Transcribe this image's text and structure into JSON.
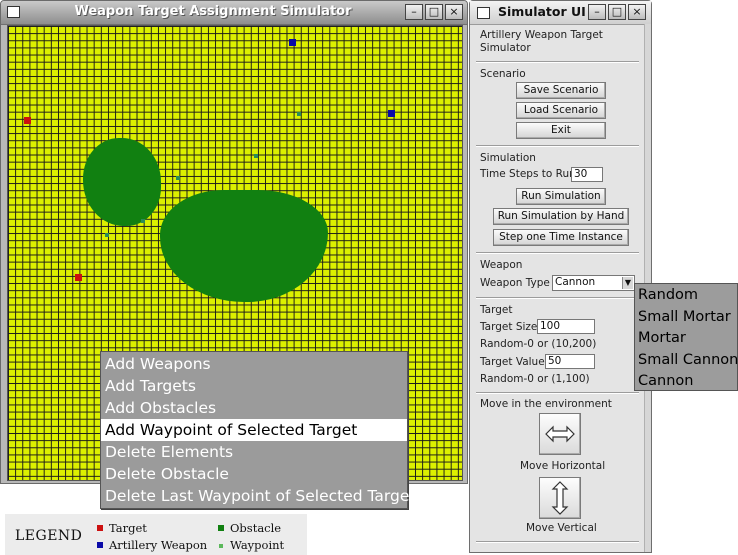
{
  "main_window": {
    "title": "Weapon Target Assignment Simulator",
    "controls": {
      "minimize": "–",
      "maximize": "□",
      "close": "×"
    }
  },
  "context_menu": {
    "items": [
      "Add Weapons",
      "Add Targets",
      "Add Obstacles",
      "Add Waypoint of Selected Target",
      "Delete Elements",
      "Delete Obstacle",
      "Delete Last Waypoint of Selected Target"
    ],
    "selected": "Add Waypoint of Selected Target"
  },
  "legend": {
    "title": "LEGEND",
    "items": {
      "target": {
        "label": "Target",
        "color": "#cc1010"
      },
      "artillery": {
        "label": "Artillery Weapon",
        "color": "#0a0aa8"
      },
      "obstacle": {
        "label": "Obstacle",
        "color": "#118011"
      },
      "waypoint": {
        "label": "Waypoint",
        "color": "#5bb85b"
      }
    }
  },
  "ui_window": {
    "title": "Simulator UI",
    "controls": {
      "minimize": "–",
      "maximize": "□",
      "close": "×"
    },
    "subtitle_line1": "Artillery Weapon Target",
    "subtitle_line2": "Simulator",
    "scenario": {
      "heading": "Scenario",
      "save": "Save Scenario",
      "load": "Load Scenario",
      "exit": "Exit"
    },
    "simulation": {
      "heading": "Simulation",
      "time_steps_label": "Time Steps to Run",
      "time_steps_value": "30",
      "run": "Run Simulation",
      "run_by_hand": "Run Simulation by Hand",
      "step": "Step one Time Instance"
    },
    "weapon": {
      "heading": "Weapon",
      "type_label": "Weapon Type",
      "type_value": "Cannon",
      "options": [
        "Random",
        "Small Mortar",
        "Mortar",
        "Small Cannon",
        "Cannon"
      ]
    },
    "target": {
      "heading": "Target",
      "size_label": "Target Size",
      "size_value": "100",
      "size_hint": "Random-0 or (10,200)",
      "value_label": "Target Value",
      "value_value": "50",
      "value_hint": "Random-0 or (1,100)"
    },
    "move": {
      "heading": "Move in the environment",
      "horizontal": "Move Horizontal",
      "vertical": "Move Vertical",
      "horizontal_icon": "horizontal-arrows-icon",
      "vertical_icon": "vertical-arrows-icon"
    }
  }
}
